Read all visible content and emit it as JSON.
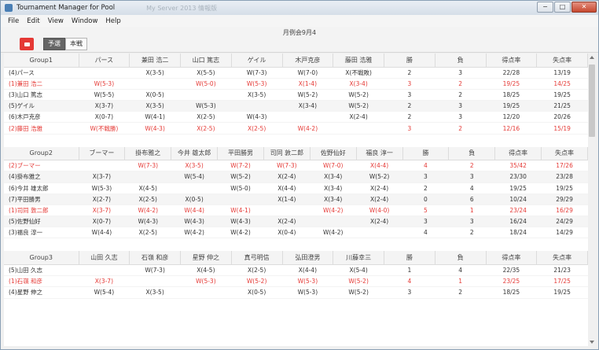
{
  "window": {
    "title": "Tournament Manager for Pool",
    "title_ghost": "My Server 2013 情報版",
    "controls": [
      "−",
      "□",
      "✕"
    ]
  },
  "menu": [
    "File",
    "Edit",
    "View",
    "Window",
    "Help"
  ],
  "toolbar": {
    "icon": "stop-icon",
    "event_title": "月例会9月4",
    "tabs": [
      {
        "label": "予選",
        "active": true
      },
      {
        "label": "本戦",
        "active": false
      }
    ]
  },
  "groups": [
    {
      "name": "Group1",
      "columns": [
        "パース",
        "兼田 浩二",
        "山口 篤志",
        "ゲイル",
        "木戸克彦",
        "藤田 浩雅",
        "勝",
        "負",
        "得点率",
        "失点率"
      ],
      "rows": [
        {
          "label": "(4)パース",
          "red": false,
          "cells": [
            "",
            "X(3-5)",
            "X(5-5)",
            "W(7-3)",
            "W(7-0)",
            "X(不戦敗)",
            "2",
            "3",
            "22/28",
            "13/19"
          ]
        },
        {
          "label": "(1)兼田 浩二",
          "red": true,
          "cells": [
            "W(5-3)",
            "",
            "W(5-0)",
            "W(5-3)",
            "X(1-4)",
            "X(3-4)",
            "3",
            "2",
            "19/25",
            "14/25"
          ]
        },
        {
          "label": "(3)山口 篤志",
          "red": false,
          "cells": [
            "W(5-5)",
            "X(0-5)",
            "",
            "X(3-5)",
            "W(5-2)",
            "W(5-2)",
            "3",
            "2",
            "18/25",
            "19/25"
          ]
        },
        {
          "label": "(5)ゲイル",
          "red": false,
          "cells": [
            "X(3-7)",
            "X(3-5)",
            "W(5-3)",
            "",
            "X(3-4)",
            "W(5-2)",
            "2",
            "3",
            "19/25",
            "21/25"
          ]
        },
        {
          "label": "(6)木戸克彦",
          "red": false,
          "cells": [
            "X(0-7)",
            "W(4-1)",
            "X(2-5)",
            "W(4-3)",
            "",
            "X(2-4)",
            "2",
            "3",
            "12/20",
            "20/26"
          ]
        },
        {
          "label": "(2)藤田 浩雅",
          "red": true,
          "cells": [
            "W(不戦勝)",
            "W(4-3)",
            "X(2-5)",
            "X(2-5)",
            "W(4-2)",
            "",
            "3",
            "2",
            "12/16",
            "15/19"
          ]
        }
      ]
    },
    {
      "name": "Group2",
      "columns": [
        "ブーマー",
        "掛布雅之",
        "今井 雄太郎",
        "平田勝男",
        "司同 敦二郎",
        "佐野仙好",
        "福良 淳一",
        "勝",
        "負",
        "得点率",
        "失点率"
      ],
      "rows": [
        {
          "label": "(2)ブーマー",
          "red": true,
          "cells": [
            "",
            "W(7-3)",
            "X(3-5)",
            "W(7-2)",
            "W(7-3)",
            "W(7-0)",
            "X(4-4)",
            "4",
            "2",
            "35/42",
            "17/26"
          ]
        },
        {
          "label": "(4)掛布雅之",
          "red": false,
          "cells": [
            "X(3-7)",
            "",
            "W(5-4)",
            "W(5-2)",
            "X(2-4)",
            "X(3-4)",
            "W(5-2)",
            "3",
            "3",
            "23/30",
            "23/28"
          ]
        },
        {
          "label": "(6)今井 雄太郎",
          "red": false,
          "cells": [
            "W(5-3)",
            "X(4-5)",
            "",
            "W(5-0)",
            "X(4-4)",
            "X(3-4)",
            "X(2-4)",
            "2",
            "4",
            "19/25",
            "19/25"
          ]
        },
        {
          "label": "(7)平田勝男",
          "red": false,
          "cells": [
            "X(2-7)",
            "X(2-5)",
            "X(0-5)",
            "",
            "X(1-4)",
            "X(3-4)",
            "X(2-4)",
            "0",
            "6",
            "10/24",
            "29/29"
          ]
        },
        {
          "label": "(1)司同 敦二郎",
          "red": true,
          "cells": [
            "X(3-7)",
            "W(4-2)",
            "W(4-4)",
            "W(4-1)",
            "",
            "W(4-2)",
            "W(4-0)",
            "5",
            "1",
            "23/24",
            "16/29"
          ]
        },
        {
          "label": "(5)佐野仙好",
          "red": false,
          "cells": [
            "X(0-7)",
            "W(4-3)",
            "W(4-3)",
            "W(4-3)",
            "X(2-4)",
            "",
            "X(2-4)",
            "3",
            "3",
            "16/24",
            "24/29"
          ]
        },
        {
          "label": "(3)福良 淳一",
          "red": false,
          "cells": [
            "W(4-4)",
            "X(2-5)",
            "W(4-2)",
            "W(4-2)",
            "X(0-4)",
            "W(4-2)",
            "",
            "4",
            "2",
            "18/24",
            "14/29"
          ]
        }
      ]
    },
    {
      "name": "Group3",
      "columns": [
        "山田 久志",
        "石嶺 和彦",
        "星野 伸之",
        "真弓明信",
        "弘田澄男",
        "川藤幸三",
        "勝",
        "負",
        "得点率",
        "失点率"
      ],
      "rows": [
        {
          "label": "(5)山田 久志",
          "red": false,
          "cells": [
            "",
            "W(7-3)",
            "X(4-5)",
            "X(2-5)",
            "X(4-4)",
            "X(5-4)",
            "1",
            "4",
            "22/35",
            "21/23"
          ]
        },
        {
          "label": "(1)石嶺 和彦",
          "red": true,
          "cells": [
            "X(3-7)",
            "",
            "W(5-3)",
            "W(5-2)",
            "W(5-3)",
            "W(5-2)",
            "4",
            "1",
            "23/25",
            "17/25"
          ]
        },
        {
          "label": "(4)星野 伸之",
          "red": false,
          "cells": [
            "W(5-4)",
            "X(3-5)",
            "",
            "X(0-5)",
            "W(5-3)",
            "W(5-2)",
            "3",
            "2",
            "18/25",
            "19/25"
          ]
        }
      ]
    }
  ],
  "colors": {
    "accent": "#e53935",
    "header_bg": "#f4f4f4"
  }
}
